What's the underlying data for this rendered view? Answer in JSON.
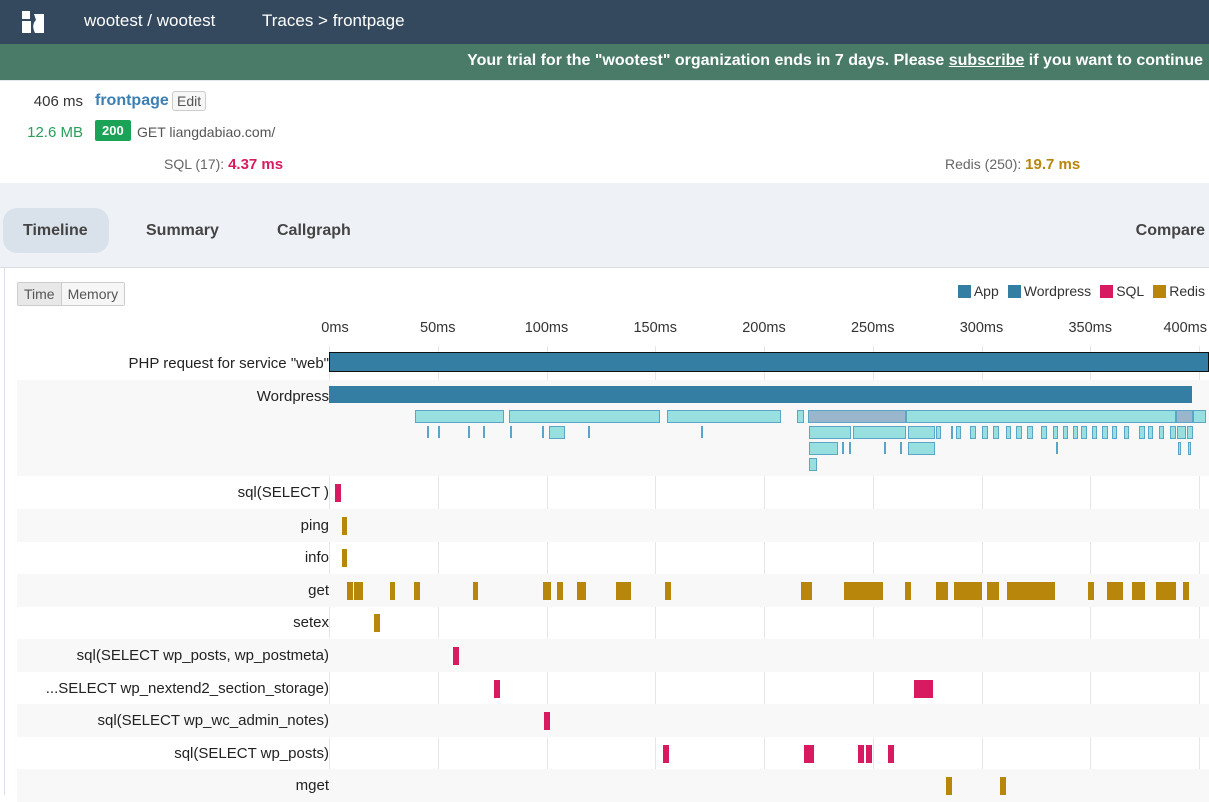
{
  "header": {
    "org": "wootest / wootest",
    "breadcrumb": "Traces > frontpage",
    "logo": "tideways-logo"
  },
  "banner": {
    "text_before": "Your trial for the \"wootest\" organization ends in 7 days. Please ",
    "link": "subscribe",
    "text_after": " if you want to continue"
  },
  "trace": {
    "duration": "406 ms",
    "name": "frontpage",
    "edit_label": "Edit",
    "memory": "12.6 MB",
    "status": "200",
    "request": "GET liangdabiao.com/",
    "sql_label": "SQL (17):",
    "sql_time": "4.37 ms",
    "redis_label": "Redis (250):",
    "redis_time": "19.7 ms"
  },
  "tabs": [
    {
      "label": "Timeline",
      "active": true
    },
    {
      "label": "Summary"
    },
    {
      "label": "Callgraph"
    },
    {
      "label": "Compare"
    }
  ],
  "view_toggle": {
    "options": [
      "Time",
      "Memory"
    ],
    "selected": "Time"
  },
  "legend": [
    {
      "label": "App",
      "color": "#347ea4"
    },
    {
      "label": "Wordpress",
      "color": "#347ea4"
    },
    {
      "label": "SQL",
      "color": "#d81b60"
    },
    {
      "label": "Redis",
      "color": "#b8860b"
    }
  ],
  "axis": {
    "ticks": [
      "0ms",
      "50ms",
      "100ms",
      "150ms",
      "200ms",
      "250ms",
      "300ms",
      "350ms",
      "400ms"
    ],
    "max_ms": 400
  },
  "timeline": {
    "app": {
      "label": "PHP request for service \"web\"",
      "spans": [
        [
          0,
          406
        ]
      ]
    },
    "wordpress": {
      "label": "Wordpress",
      "spans": [
        [
          0,
          397
        ]
      ],
      "levels": [
        [
          [
            39.6,
            40.9
          ],
          [
            82.7,
            69.6
          ],
          [
            155.4,
            52.4
          ],
          [
            215.3,
            2.9
          ],
          [
            220,
            45.5,
            1
          ],
          [
            265.5,
            124
          ],
          [
            389.5,
            7.7,
            1
          ],
          [
            397.2,
            6
          ]
        ],
        [
          [
            45,
            0.8
          ],
          [
            50,
            0.8
          ],
          [
            64,
            0.8
          ],
          [
            71,
            0.8
          ],
          [
            83,
            0.8
          ],
          [
            98,
            0.8
          ],
          [
            101.1,
            7.6
          ],
          [
            119,
            0.8
          ],
          [
            171,
            0.8
          ],
          [
            220.6,
            19.5
          ],
          [
            240.9,
            24.4
          ],
          [
            266.2,
            12.2
          ],
          [
            278.9,
            2.5
          ],
          [
            286,
            1
          ],
          [
            288.3,
            2.5
          ],
          [
            294.8,
            2.5
          ],
          [
            300.3,
            2.5
          ],
          [
            305.5,
            2.5
          ],
          [
            311.2,
            2.5
          ],
          [
            316,
            2.5
          ],
          [
            321.1,
            2.5
          ],
          [
            327.4,
            2.5
          ],
          [
            332.9,
            2.5
          ],
          [
            337.3,
            2.5
          ],
          [
            342,
            2.5
          ],
          [
            345.9,
            2.5
          ],
          [
            350.8,
            2.5
          ],
          [
            355.5,
            2.5
          ],
          [
            360,
            2.5
          ],
          [
            365.5,
            2.5
          ],
          [
            372.5,
            2.5
          ],
          [
            376.4,
            2.5
          ],
          [
            381.6,
            2.5
          ],
          [
            386.8,
            2.5
          ],
          [
            389.9,
            4
          ],
          [
            394.6,
            2.5
          ]
        ],
        [
          [
            220.6,
            13.4
          ],
          [
            236,
            0.8
          ],
          [
            239,
            0.8
          ],
          [
            255,
            0.8
          ],
          [
            262.6,
            0.8
          ],
          [
            266.2,
            12.2
          ],
          [
            334.2,
            0.6
          ],
          [
            390.2,
            1.5
          ],
          [
            395,
            1.5
          ]
        ],
        [
          [
            220.6,
            3.8
          ]
        ]
      ]
    },
    "rows": [
      {
        "label": "sql(SELECT )",
        "kind": "sql",
        "spans": [
          [
            2.8,
            2.8
          ]
        ]
      },
      {
        "label": "ping",
        "kind": "redis",
        "spans": [
          [
            6,
            2.5
          ]
        ]
      },
      {
        "label": "info",
        "kind": "redis",
        "spans": [
          [
            6,
            2.5
          ]
        ]
      },
      {
        "label": "get",
        "kind": "redis",
        "spans": [
          [
            8.1,
            2.9
          ],
          [
            11.5,
            4.1
          ],
          [
            27.9,
            2.6
          ],
          [
            39.1,
            2.7
          ],
          [
            66.2,
            2.3
          ],
          [
            98.3,
            3.9
          ],
          [
            104.8,
            2.6
          ],
          [
            113.9,
            4.4
          ],
          [
            132,
            6.8
          ],
          [
            154.3,
            3.1
          ],
          [
            216.9,
            5
          ],
          [
            236.7,
            18
          ],
          [
            264.8,
            2.9
          ],
          [
            278.9,
            5.7
          ],
          [
            287.3,
            13
          ],
          [
            302.4,
            5.7
          ],
          [
            311.7,
            22
          ],
          [
            348.8,
            2.9
          ],
          [
            357.5,
            7.4
          ],
          [
            369.1,
            6.3
          ],
          [
            380,
            9.5
          ],
          [
            392.8,
            2.6
          ]
        ]
      },
      {
        "label": "setex",
        "kind": "redis",
        "spans": [
          [
            20.7,
            2.8
          ]
        ]
      },
      {
        "label": "sql(SELECT wp_posts, wp_postmeta)",
        "kind": "sql",
        "spans": [
          [
            57,
            2.8
          ]
        ]
      },
      {
        "label": "...SELECT wp_nextend2_section_storage)",
        "kind": "sql",
        "spans": [
          [
            75.9,
            2.8
          ],
          [
            269,
            8.7
          ]
        ]
      },
      {
        "label": "sql(SELECT wp_wc_admin_notes)",
        "kind": "sql",
        "spans": [
          [
            98.9,
            2.8
          ]
        ]
      },
      {
        "label": "sql(SELECT wp_posts)",
        "kind": "sql",
        "spans": [
          [
            153.6,
            2.8
          ],
          [
            218.4,
            4.6
          ],
          [
            243.2,
            2.8
          ],
          [
            246.9,
            2.8
          ],
          [
            257,
            2.8
          ]
        ]
      },
      {
        "label": "mget",
        "kind": "redis",
        "spans": [
          [
            283.7,
            2.8
          ],
          [
            308.5,
            2.8
          ]
        ]
      }
    ]
  }
}
